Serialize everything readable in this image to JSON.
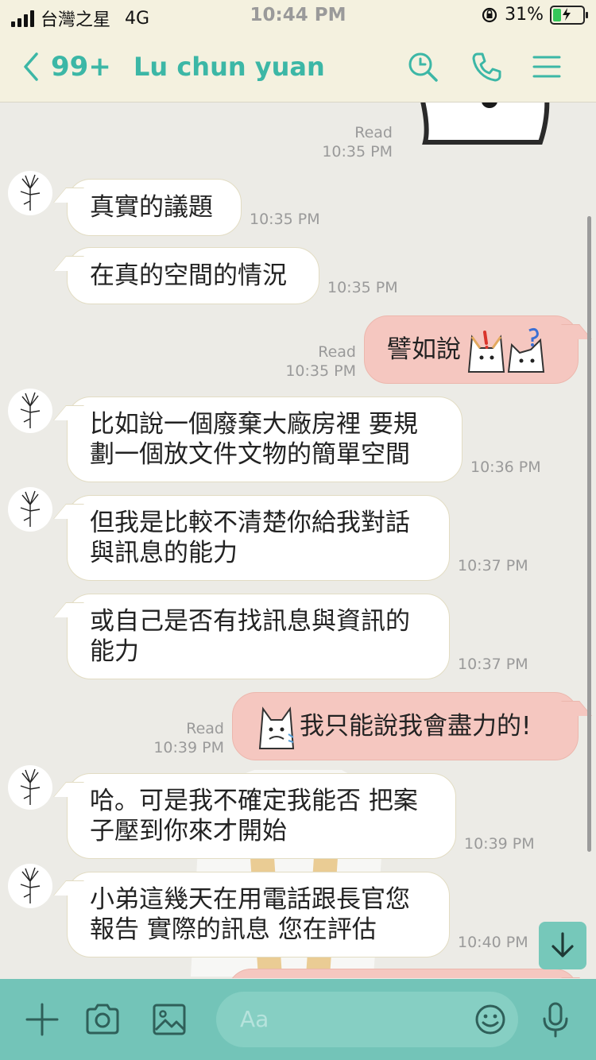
{
  "status_bar": {
    "carrier": "台灣之星",
    "network": "4G",
    "time": "10:44 PM",
    "battery": "31%",
    "battery_level": 0.31
  },
  "header": {
    "back_count": "99+",
    "contact_name": "Lu chun yuan",
    "icons": [
      "search-icon",
      "phone-icon",
      "menu-icon"
    ]
  },
  "messages": [
    {
      "side": "out",
      "type": "sticker",
      "status": "Read",
      "time": "10:35 PM"
    },
    {
      "side": "in",
      "lines": [
        "真實的議題"
      ],
      "time": "10:35 PM"
    },
    {
      "side": "in",
      "lines": [
        "在真的空間的情況"
      ],
      "time": "10:35 PM"
    },
    {
      "side": "out",
      "lines": [
        "譬如說"
      ],
      "status": "Read",
      "time": "10:35 PM",
      "emoji": "dog-emoji"
    },
    {
      "side": "in",
      "lines": [
        "比如說一個廢棄大廠房裡  要規",
        "劃一個放文件文物的簡單空間"
      ],
      "time": "10:36 PM"
    },
    {
      "side": "in",
      "lines": [
        "但我是比較不清楚你給我對話",
        "與訊息的能力"
      ],
      "time": "10:37 PM"
    },
    {
      "side": "in",
      "lines": [
        "或自己是否有找訊息與資訊的",
        "能力"
      ],
      "time": "10:37 PM"
    },
    {
      "side": "out",
      "lines": [
        "我只能說我會盡力的!"
      ],
      "status": "Read",
      "time": "10:39 PM",
      "emoji": "dog-emoji"
    },
    {
      "side": "in",
      "lines": [
        "哈。可是我不確定我能否 把案",
        "子壓到你來才開始"
      ],
      "time": "10:39 PM"
    },
    {
      "side": "in",
      "lines": [
        "小弟這幾天在用電話跟長官您",
        "報告 實際的訊息 您在評估"
      ],
      "time": "10:40 PM"
    }
  ],
  "composer": {
    "placeholder": "Aa",
    "icons": [
      "plus-icon",
      "camera-icon",
      "image-icon",
      "emoji-icon",
      "microphone-icon"
    ]
  },
  "colors": {
    "accent": "#3cb7a6",
    "header_bg": "#f4f1df",
    "outgoing_bubble": "#f5c7c0",
    "footer_bg": "#73c4b8"
  }
}
